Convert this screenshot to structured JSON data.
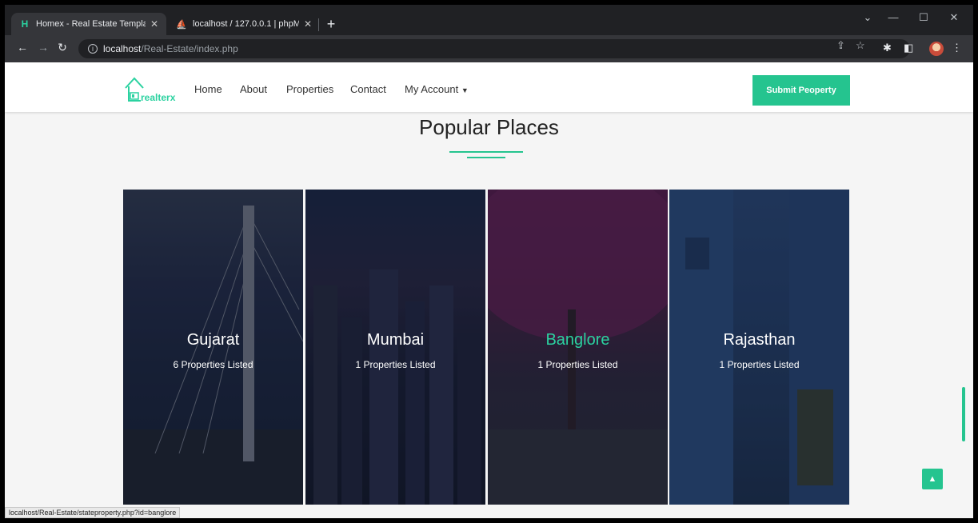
{
  "browser": {
    "tabs": [
      {
        "title": "Homex - Real Estate Template",
        "favicon": "H"
      },
      {
        "title": "localhost / 127.0.0.1 | phpMyAdm"
      }
    ],
    "url_host": "localhost",
    "url_path": "/Real-Estate/index.php",
    "status_url": "localhost/Real-Estate/stateproperty.php?id=banglore"
  },
  "site": {
    "logo_text": "realterx",
    "nav": [
      "Home",
      "About",
      "Properties",
      "Contact",
      "My Account"
    ],
    "submit_label": "Submit Peoperty",
    "accent_color": "#25c48f"
  },
  "section": {
    "title": "Popular Places",
    "places": [
      {
        "name": "Gujarat",
        "count": "6 Properties Listed"
      },
      {
        "name": "Mumbai",
        "count": "1 Properties Listed"
      },
      {
        "name": "Banglore",
        "count": "1 Properties Listed"
      },
      {
        "name": "Rajasthan",
        "count": "1 Properties Listed"
      }
    ]
  }
}
